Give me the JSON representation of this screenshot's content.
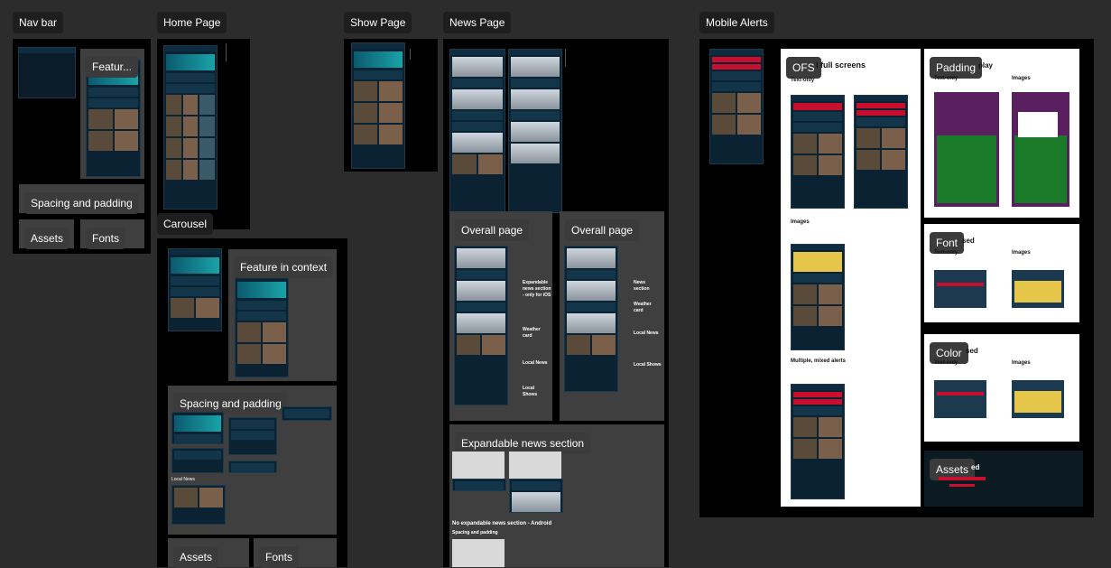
{
  "sections": {
    "nav_bar": "Nav bar",
    "home_page": "Home Page",
    "show_page": "Show Page",
    "news_page": "News Page",
    "mobile_alerts": "Mobile Alerts",
    "carousel": "Carousel"
  },
  "tags": {
    "nav_feature": "Featur...",
    "nav_spacing": "Spacing and padding",
    "nav_assets": "Assets",
    "nav_fonts": "Fonts",
    "carousel_feature": "Feature in context",
    "carousel_spacing": "Spacing and padding",
    "carousel_assets": "Assets",
    "carousel_fonts": "Fonts",
    "news_overall_ios": "Overall page",
    "news_overall_android": "Overall page",
    "news_expandable": "Expandable news section",
    "alerts_ofs": "OFS",
    "alerts_padding": "Padding",
    "alerts_font": "Font",
    "alerts_color": "Color",
    "alerts_assets": "Assets"
  },
  "news": {
    "ann_ios": [
      "Expandable news section - only for iOS",
      "Weather card",
      "Local News",
      "Local Shows"
    ],
    "ann_android": [
      "News section",
      "Weather card",
      "Local News",
      "Local Shows"
    ],
    "no_expandable": "No expandable news section - Android",
    "spacing": "Spacing and padding"
  },
  "alerts": {
    "ofs_title_rest": "l full screens",
    "text_only": "Text-only",
    "images": "Images",
    "multiple": "Multiple, mixed alerts",
    "padding_rest": "play",
    "font_rest": "sed",
    "color_rest": "sed",
    "assets_rest": "ed"
  },
  "carousel": {
    "local_news": "Local News"
  },
  "colors": {
    "canvas": "#2c2c2c",
    "frame": "#000000",
    "card": "#3f3f3f",
    "phone": "#0b2233",
    "accent_red": "#c8102e"
  }
}
